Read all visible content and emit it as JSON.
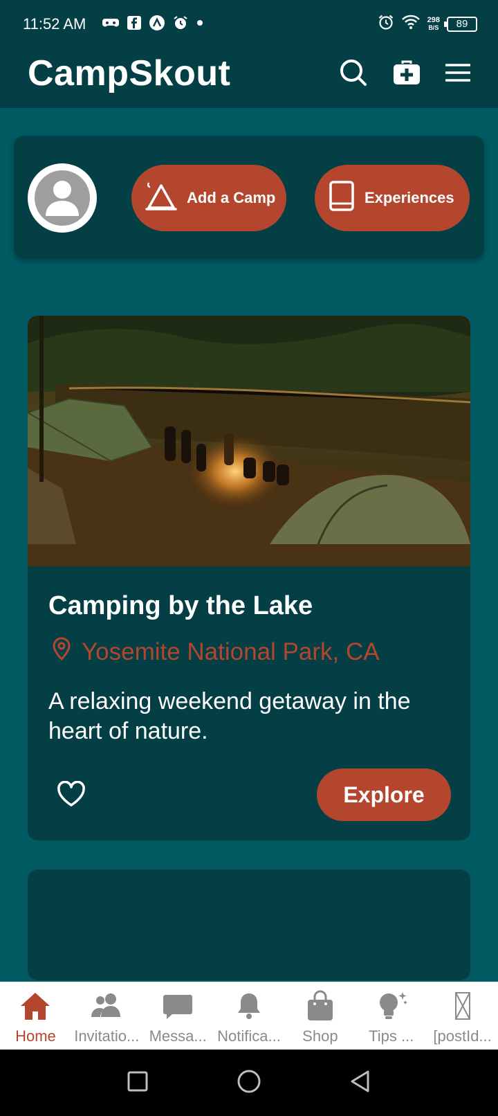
{
  "status": {
    "time": "11:52 AM",
    "net_speed_value": "298",
    "net_speed_unit": "B/S",
    "battery": "89"
  },
  "header": {
    "title": "CampSkout"
  },
  "actions": {
    "add_camp_label": "Add a Camp",
    "experiences_label": "Experiences"
  },
  "post": {
    "title": "Camping by the Lake",
    "location": "Yosemite National Park, CA",
    "description": "A relaxing weekend getaway in the heart of nature.",
    "explore_label": "Explore"
  },
  "bottom_nav": {
    "items": [
      {
        "label": "Home",
        "icon": "home-icon"
      },
      {
        "label": "Invitatio...",
        "icon": "people-icon"
      },
      {
        "label": "Messa...",
        "icon": "message-icon"
      },
      {
        "label": "Notifica...",
        "icon": "bell-icon"
      },
      {
        "label": "Shop",
        "icon": "shopping-bag-icon"
      },
      {
        "label": "Tips ...",
        "icon": "lightbulb-icon"
      },
      {
        "label": "[postId...",
        "icon": "hourglass-icon"
      }
    ]
  },
  "colors": {
    "header_bg": "#033f45",
    "page_bg": "#025a63",
    "accent": "#b5462e",
    "nav_bg": "#ffffff"
  }
}
